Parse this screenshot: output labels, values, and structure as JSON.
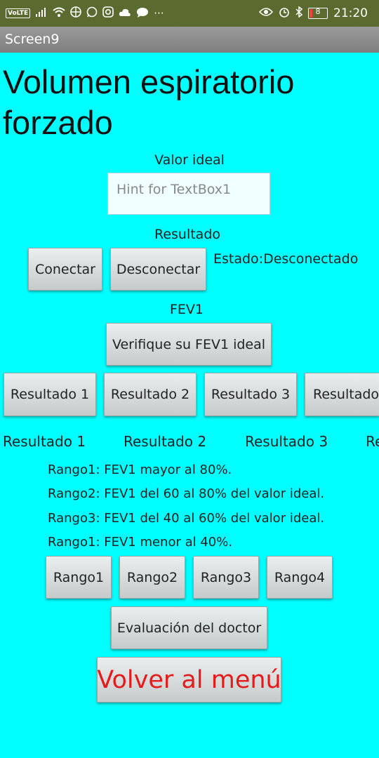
{
  "statusbar": {
    "volte": "VoLTE",
    "time": "21:20",
    "battery": "8",
    "more": "···",
    "icons": [
      "signal-icon",
      "wifi-icon",
      "basketball-icon",
      "whatsapp-icon",
      "instagram-icon",
      "cloud-icon",
      "chat-icon",
      "eye-icon",
      "alarm-icon",
      "bluetooth-icon",
      "battery-icon"
    ]
  },
  "titlebar": {
    "title": "Screen9"
  },
  "main": {
    "heading": "Volumen espiratorio forzado",
    "valor_label": "Valor ideal",
    "textbox_placeholder": "Hint for TextBox1",
    "resultado_label": "Resultado",
    "conectar": "Conectar",
    "desconectar": "Desconectar",
    "estado": "Estado:Desconectado",
    "fev1_label": "FEV1",
    "verifique": "Verifique su FEV1 ideal",
    "result_buttons": [
      "Resultado 1",
      "Resultado 2",
      "Resultado 3",
      "Resultado"
    ],
    "result_labels": [
      "Resultado 1",
      "Resultado 2",
      "Resultado 3",
      "Re"
    ],
    "ranges": [
      "Rango1: FEV1 mayor al 80%.",
      "Rango2: FEV1 del 60 al 80% del valor ideal.",
      "Rango3: FEV1 del 40 al 60% del valor ideal.",
      "Rango1: FEV1 menor al 40%."
    ],
    "range_buttons": [
      "Rango1",
      "Rango2",
      "Rango3",
      "Rango4"
    ],
    "evaluacion": "Evaluación del doctor",
    "volver": "Volver al menú"
  }
}
